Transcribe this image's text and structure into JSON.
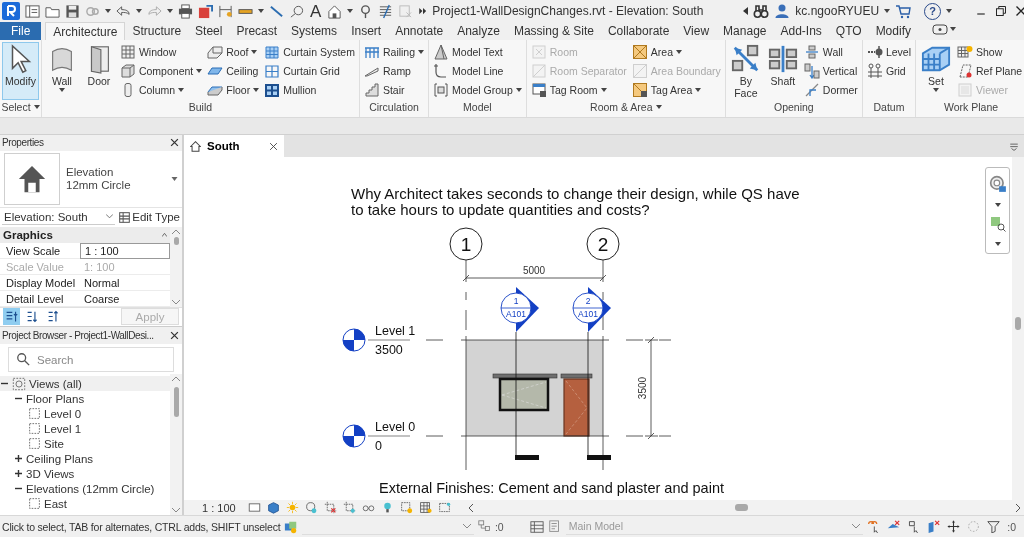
{
  "title_bar": {
    "text_tool": "A",
    "title": "Project1-WallDesignChanges.rvt - Elevation: South",
    "user": "kc.ngooRYUEU",
    "help": "?"
  },
  "ribbon_tabs": [
    {
      "label": "File",
      "kind": "file",
      "selected": false
    },
    {
      "label": "Architecture",
      "kind": "tab",
      "selected": true
    },
    {
      "label": "Structure",
      "kind": "tab",
      "selected": false
    },
    {
      "label": "Steel",
      "kind": "tab",
      "selected": false
    },
    {
      "label": "Precast",
      "kind": "tab",
      "selected": false
    },
    {
      "label": "Systems",
      "kind": "tab",
      "selected": false
    },
    {
      "label": "Insert",
      "kind": "tab",
      "selected": false
    },
    {
      "label": "Annotate",
      "kind": "tab",
      "selected": false
    },
    {
      "label": "Analyze",
      "kind": "tab",
      "selected": false
    },
    {
      "label": "Massing & Site",
      "kind": "tab",
      "selected": false
    },
    {
      "label": "Collaborate",
      "kind": "tab",
      "selected": false
    },
    {
      "label": "View",
      "kind": "tab",
      "selected": false
    },
    {
      "label": "Manage",
      "kind": "tab",
      "selected": false
    },
    {
      "label": "Add-Ins",
      "kind": "tab",
      "selected": false
    },
    {
      "label": "QTO",
      "kind": "tab",
      "selected": false
    },
    {
      "label": "Modify",
      "kind": "tab",
      "selected": false
    }
  ],
  "ribbon_panels": [
    {
      "title": "Select",
      "menu": true,
      "groups": [
        {
          "kind": "large",
          "label": "Modify",
          "dropdown": false,
          "disabled": false,
          "selected": true
        }
      ]
    },
    {
      "title": "Build",
      "menu": false,
      "groups": [
        {
          "kind": "large",
          "label": "Wall",
          "dropdown": true,
          "disabled": false,
          "selected": false
        },
        {
          "kind": "large",
          "label": "Door",
          "dropdown": false,
          "disabled": false,
          "selected": false
        },
        {
          "kind": "stack",
          "items": [
            {
              "label": "Window",
              "dropdown": false,
              "disabled": false,
              "selected": false
            },
            {
              "label": "Component",
              "dropdown": true,
              "disabled": false,
              "selected": false
            },
            {
              "label": "Column",
              "dropdown": true,
              "disabled": false,
              "selected": false
            }
          ]
        },
        {
          "kind": "stack",
          "items": [
            {
              "label": "Roof",
              "dropdown": true,
              "disabled": false,
              "selected": false
            },
            {
              "label": "Ceiling",
              "dropdown": false,
              "disabled": false,
              "selected": false
            },
            {
              "label": "Floor",
              "dropdown": true,
              "disabled": false,
              "selected": false
            }
          ]
        },
        {
          "kind": "stack",
          "items": [
            {
              "label": "Curtain System",
              "dropdown": false,
              "disabled": false,
              "selected": false
            },
            {
              "label": "Curtain Grid",
              "dropdown": false,
              "disabled": false,
              "selected": false
            },
            {
              "label": "Mullion",
              "dropdown": false,
              "disabled": false,
              "selected": false
            }
          ]
        }
      ]
    },
    {
      "title": "Circulation",
      "menu": false,
      "groups": [
        {
          "kind": "stack",
          "items": [
            {
              "label": "Railing",
              "dropdown": true,
              "disabled": false,
              "selected": false
            },
            {
              "label": "Ramp",
              "dropdown": false,
              "disabled": false,
              "selected": false
            },
            {
              "label": "Stair",
              "dropdown": false,
              "disabled": false,
              "selected": false
            }
          ]
        }
      ]
    },
    {
      "title": "Model",
      "menu": false,
      "groups": [
        {
          "kind": "stack",
          "items": [
            {
              "label": "Model Text",
              "dropdown": false,
              "disabled": false,
              "selected": false
            },
            {
              "label": "Model Line",
              "dropdown": false,
              "disabled": false,
              "selected": false
            },
            {
              "label": "Model Group",
              "dropdown": true,
              "disabled": false,
              "selected": false
            }
          ]
        }
      ]
    },
    {
      "title": "Room & Area",
      "menu": true,
      "groups": [
        {
          "kind": "stack",
          "items": [
            {
              "label": "Room",
              "dropdown": false,
              "disabled": true,
              "selected": false
            },
            {
              "label": "Room Separator",
              "dropdown": false,
              "disabled": true,
              "selected": false
            },
            {
              "label": "Tag Room",
              "dropdown": true,
              "disabled": false,
              "selected": false
            }
          ]
        },
        {
          "kind": "stack",
          "items": [
            {
              "label": "Area",
              "dropdown": true,
              "disabled": false,
              "selected": false
            },
            {
              "label": "Area Boundary",
              "dropdown": false,
              "disabled": true,
              "selected": false
            },
            {
              "label": "Tag Area",
              "dropdown": true,
              "disabled": false,
              "selected": false
            }
          ]
        }
      ]
    },
    {
      "title": "Opening",
      "menu": false,
      "groups": [
        {
          "kind": "large",
          "label": "By Face",
          "dropdown": false,
          "disabled": false,
          "selected": false
        },
        {
          "kind": "large",
          "label": "Shaft",
          "dropdown": false,
          "disabled": false,
          "selected": false
        },
        {
          "kind": "stack",
          "items": [
            {
              "label": "Wall",
              "dropdown": false,
              "disabled": false,
              "selected": false
            },
            {
              "label": "Vertical",
              "dropdown": false,
              "disabled": false,
              "selected": false
            },
            {
              "label": "Dormer",
              "dropdown": false,
              "disabled": false,
              "selected": false
            }
          ]
        }
      ]
    },
    {
      "title": "Datum",
      "menu": false,
      "groups": [
        {
          "kind": "stack",
          "items": [
            {
              "label": "Level",
              "dropdown": false,
              "disabled": false,
              "selected": false
            },
            {
              "label": "Grid",
              "dropdown": false,
              "disabled": false,
              "selected": false
            }
          ]
        }
      ]
    },
    {
      "title": "Work Plane",
      "menu": false,
      "groups": [
        {
          "kind": "large",
          "label": "Set",
          "dropdown": true,
          "disabled": false,
          "selected": false
        },
        {
          "kind": "stack",
          "items": [
            {
              "label": "Show",
              "dropdown": false,
              "disabled": false,
              "selected": false
            },
            {
              "label": "Ref Plane",
              "dropdown": false,
              "disabled": false,
              "selected": false
            },
            {
              "label": "Viewer",
              "dropdown": false,
              "disabled": true,
              "selected": false
            }
          ]
        }
      ]
    }
  ],
  "properties": {
    "title": "Properties",
    "type_family": "Elevation",
    "type_name": "12mm Circle",
    "instance_selector": "Elevation: South",
    "edit_type": "Edit Type",
    "group": {
      "label": "Graphics",
      "expanded": true
    },
    "rows": [
      {
        "label": "View Scale",
        "value": "1 : 100",
        "kind": "input",
        "disabled": false
      },
      {
        "label": "Scale Value",
        "value": "1: 100",
        "kind": "text",
        "disabled": true
      },
      {
        "label": "Display Model",
        "value": "Normal",
        "kind": "text",
        "disabled": false
      },
      {
        "label": "Detail Level",
        "value": "Coarse",
        "kind": "text",
        "disabled": false
      }
    ],
    "sort_buttons": [
      {
        "selected": true
      },
      {
        "selected": false
      },
      {
        "selected": false
      }
    ],
    "apply": {
      "label": "Apply",
      "disabled": true
    }
  },
  "project_browser": {
    "title": "Project Browser - Project1-WallDesi...",
    "search": {
      "placeholder": "Search"
    },
    "tree": [
      {
        "label": "Views (all)",
        "kind": "root",
        "expanded": true,
        "children": [
          {
            "label": "Floor Plans",
            "kind": "group",
            "expanded": true,
            "children": [
              {
                "label": "Level 0",
                "kind": "view"
              },
              {
                "label": "Level 1",
                "kind": "view"
              },
              {
                "label": "Site",
                "kind": "view"
              }
            ]
          },
          {
            "label": "Ceiling Plans",
            "kind": "group",
            "expanded": false
          },
          {
            "label": "3D Views",
            "kind": "group",
            "expanded": false
          },
          {
            "label": "Elevations (12mm Circle)",
            "kind": "group",
            "expanded": true,
            "children": [
              {
                "label": "East",
                "kind": "view"
              }
            ]
          }
        ]
      }
    ]
  },
  "view": {
    "tabs": [
      {
        "label": "South",
        "selected": true
      }
    ],
    "note": "Why Architect takes seconds to change their design, while QS have to take hours to update quantities and costs?",
    "grids": [
      {
        "label": "1"
      },
      {
        "label": "2"
      }
    ],
    "width_dimension": "5000",
    "sections": [
      {
        "number": "1",
        "sheet": "A101"
      },
      {
        "number": "2",
        "sheet": "A101"
      }
    ],
    "levels": [
      {
        "name": "Level 1",
        "elevation": "3500"
      },
      {
        "name": "Level 0",
        "elevation": "0"
      }
    ],
    "height_dimension": "3500",
    "caption": "External Finishes: Cement and sand plaster and paint"
  },
  "view_control_bar": {
    "scale": "1 : 100"
  },
  "status_bar": {
    "message": "Click to select, TAB for alternates, CTRL adds, SHIFT unselect",
    "workset_count": ":0",
    "design_option": "Main Model",
    "filter_count": ":0"
  }
}
